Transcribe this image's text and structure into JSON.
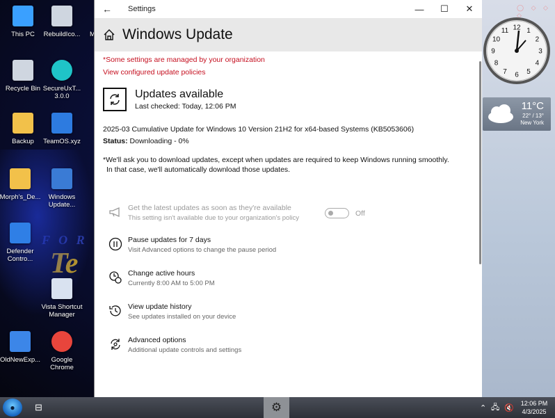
{
  "desktop": {
    "icons": [
      {
        "label": "This PC",
        "icon": "pc-icon"
      },
      {
        "label": "RebuildIco...",
        "icon": "robot-icon"
      },
      {
        "label": "Recycle Bin",
        "icon": "recycle-bin-icon"
      },
      {
        "label": "SecureUxT... 3.0.0",
        "icon": "brush-icon"
      },
      {
        "label": "Backup",
        "icon": "folder-icon"
      },
      {
        "label": "TeamOS.xyz",
        "icon": "ie-icon"
      },
      {
        "label": "Morph's_De...",
        "icon": "folder-icon"
      },
      {
        "label": "Windows Update...",
        "icon": "no-update-icon"
      },
      {
        "label": "Defender Contro...",
        "icon": "defender-icon"
      },
      {
        "label": "Vista Shortcut Manager",
        "icon": "shortcut-icon"
      },
      {
        "label": "OldNewExp...",
        "icon": "shield-icon"
      },
      {
        "label": "Google Chrome",
        "icon": "chrome-icon"
      }
    ],
    "partial_icon_letter": "M"
  },
  "window": {
    "title": "Settings",
    "page_title": "Windows Update",
    "managed_notice": "*Some settings are managed by your organization",
    "policies_link": "View configured update policies",
    "status_title": "Updates available",
    "last_checked": "Last checked: Today, 12:06 PM",
    "update_name": "2025-03 Cumulative Update for Windows 10 Version 21H2 for x64-based Systems (KB5053606)",
    "status_label": "Status:",
    "status_value": "Downloading - 0%",
    "download_notice_1": "*We'll ask you to download updates, except when updates are required to keep Windows running smoothly.",
    "download_notice_2": "In that case, we'll automatically download those updates.",
    "options": [
      {
        "label": "Get the latest updates as soon as they're available",
        "sub": "This setting isn't available due to your organization's policy",
        "icon": "megaphone-icon",
        "toggle": "Off"
      },
      {
        "label": "Pause updates for 7 days",
        "sub": "Visit Advanced options to change the pause period",
        "icon": "pause-icon"
      },
      {
        "label": "Change active hours",
        "sub": "Currently 8:00 AM to 5:00 PM",
        "icon": "active-hours-icon"
      },
      {
        "label": "View update history",
        "sub": "See updates installed on your device",
        "icon": "history-icon"
      },
      {
        "label": "Advanced options",
        "sub": "Additional update controls and settings",
        "icon": "advanced-options-icon"
      }
    ]
  },
  "gadgets": {
    "clock_numbers": [
      "12",
      "1",
      "2",
      "3",
      "4",
      "5",
      "6",
      "7",
      "8",
      "9",
      "10",
      "11"
    ],
    "weather_temp": "11°C",
    "weather_range": "22° / 13°",
    "weather_city": "New York"
  },
  "taskbar": {
    "time": "12:06 PM",
    "date": "4/3/2025"
  }
}
